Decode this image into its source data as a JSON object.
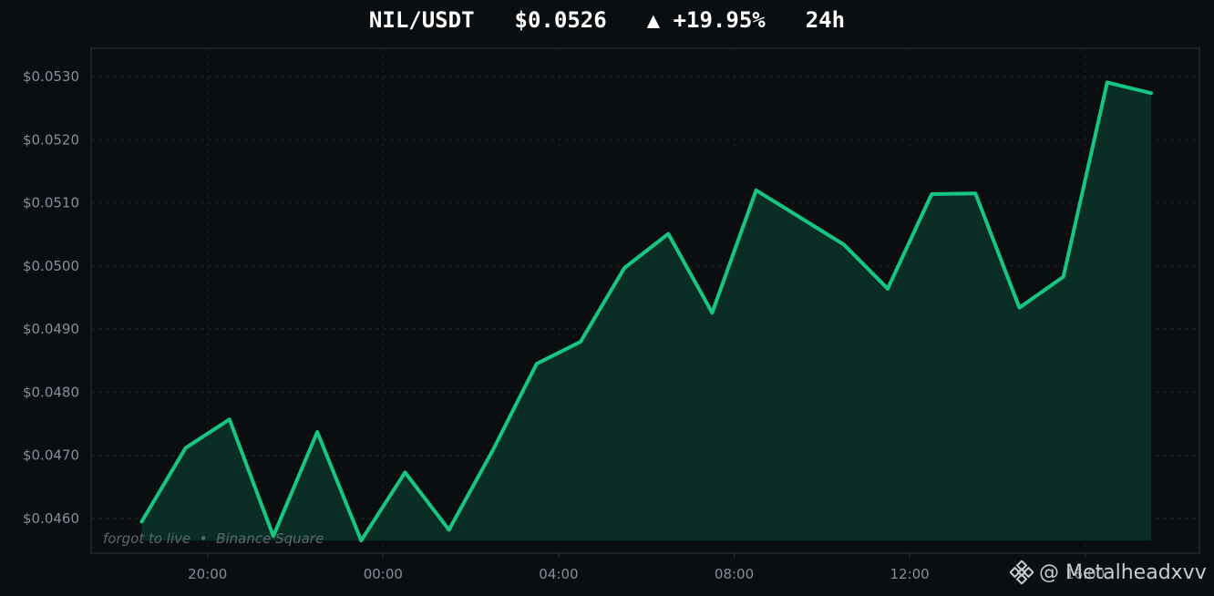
{
  "header": {
    "pair": "NIL/USDT",
    "price": "$0.0526",
    "change": "▲ +19.95%",
    "period": "24h"
  },
  "chart_data": {
    "type": "area",
    "x": [
      "18:30",
      "19:30",
      "20:30",
      "21:30",
      "22:30",
      "23:30",
      "00:30",
      "01:30",
      "02:30",
      "03:30",
      "04:30",
      "05:30",
      "06:30",
      "07:30",
      "08:30",
      "09:30",
      "10:30",
      "11:30",
      "12:30",
      "13:30",
      "14:30",
      "15:30",
      "16:30",
      "17:30"
    ],
    "series": [
      {
        "values": [
          0.04595,
          0.04712,
          0.04757,
          0.04572,
          0.04737,
          0.04565,
          0.04673,
          0.04582,
          0.04708,
          0.04845,
          0.0488,
          0.04997,
          0.05051,
          0.04926,
          0.0512,
          0.05077,
          0.05034,
          0.04964,
          0.05114,
          0.05115,
          0.04934,
          0.04983,
          0.05291,
          0.05274
        ],
        "color": "#16c784"
      }
    ],
    "xticks": [
      "20:00",
      "00:00",
      "04:00",
      "08:00",
      "12:00",
      "16:00"
    ],
    "yticks": [
      "$0.0460",
      "$0.0470",
      "$0.0480",
      "$0.0490",
      "$0.0500",
      "$0.0510",
      "$0.0520",
      "$0.0530"
    ],
    "ylim": [
      0.04545,
      0.05345
    ],
    "xlabel": "",
    "ylabel": "",
    "grid": true,
    "fill_baseline": 0.04565,
    "line_color": "#16c784",
    "fill_color": "#0a2e25",
    "background": "#0b0e11"
  },
  "credit": "forgot to live  •  Binance Square",
  "watermark": {
    "text": "@ Metalheadxvv",
    "icon": "binance-logo-icon"
  }
}
